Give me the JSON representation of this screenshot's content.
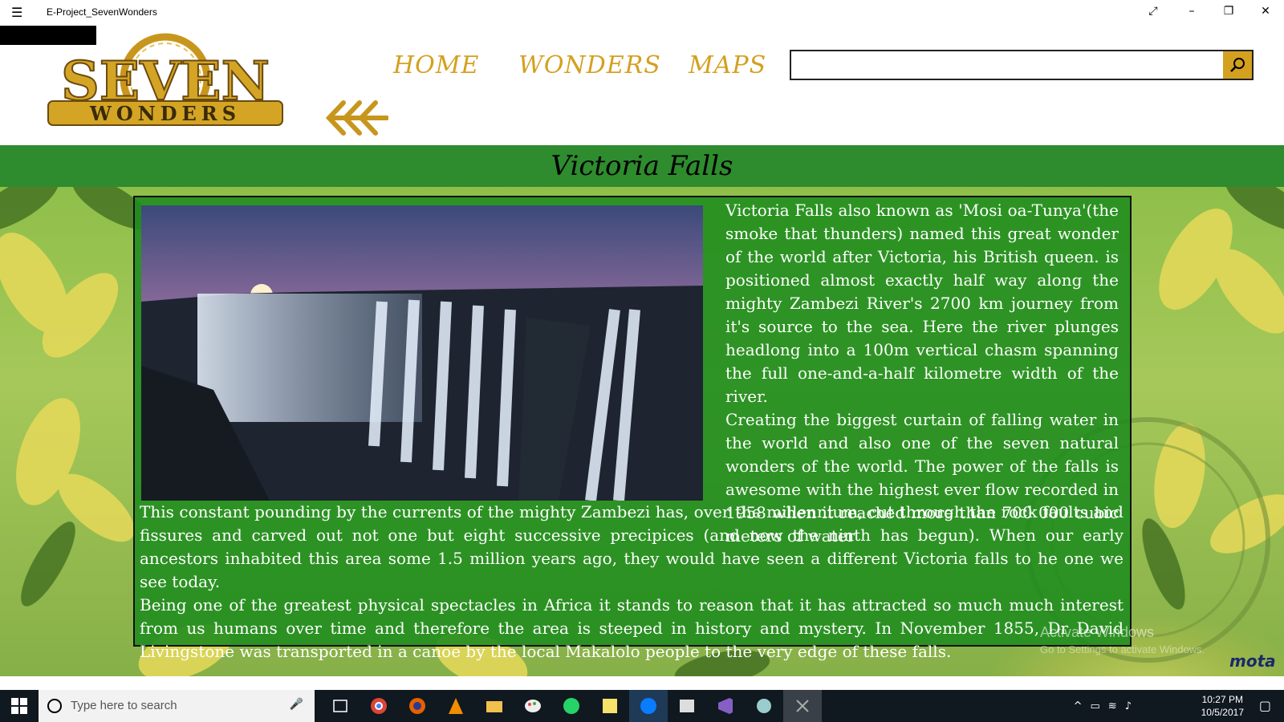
{
  "window": {
    "title": "E-Project_SevenWonders",
    "menu_icon": "hamburger-icon",
    "controls": [
      "fullscreen-icon",
      "minimize-icon",
      "restore-icon",
      "close-icon"
    ]
  },
  "logo": {
    "line1": "SEVEN",
    "line2": "WONDERS"
  },
  "nav": {
    "home": "HOME",
    "wonders": "WONDERS",
    "maps": "MAPS"
  },
  "search": {
    "value": "",
    "placeholder": ""
  },
  "page": {
    "title": "Victoria Falls",
    "paragraph1": "Victoria Falls also known as 'Mosi oa-Tunya'(the smoke that thunders) named this great wonder of the world after Victoria, his British queen. is positioned almost exactly half way along the mighty Zambezi River's 2700 km journey from it's source to the sea. Here the river plunges headlong into a 100m vertical chasm spanning the full one-and-a-half kilometre width of the river.",
    "paragraph2": "Creating the biggest curtain of falling water in the world and also one of the seven natural wonders of the world. The power of the falls is awesome with the highest ever flow recorded in 1958 when it reached more than 700 000 cubic meters of water",
    "paragraph3": "This constant pounding by the currents of the mighty Zambezi has, over the millennium, cut through the rock faults and fissures and carved out not one but eight successive precipices (and now the ninth has begun). When our early ancestors inhabited this area some 1.5 million years ago, they would have seen a different Victoria falls to he one we see today.",
    "paragraph4": "Being one of the greatest physical spectacles in Africa it stands to reason that it has attracted so much much interest from us humans over time and therefore the area is steeped in history and mystery. In November 1855, Dr David Livingstone was transported in a canoe by the local Makalolo people to the very edge of these falls."
  },
  "watermark": {
    "line1": "Activate Windows",
    "line2": "Go to Settings to activate Windows.",
    "brand": "mota"
  },
  "taskbar": {
    "search_placeholder": "Type here to search",
    "time": "10:27 PM",
    "date": "10/5/2017",
    "apps": [
      "task-view-icon",
      "chrome-icon",
      "firefox-icon",
      "vlc-icon",
      "file-explorer-icon",
      "paint-icon",
      "whatsapp-icon",
      "sticky-notes-icon",
      "messenger-icon",
      "media-icon",
      "visual-studio-icon",
      "paint-brush-icon",
      "app-icon"
    ]
  },
  "colors": {
    "accent_gold": "#d4a020",
    "header_green": "#2e8b2e",
    "panel_green": "#1e8c1e"
  }
}
